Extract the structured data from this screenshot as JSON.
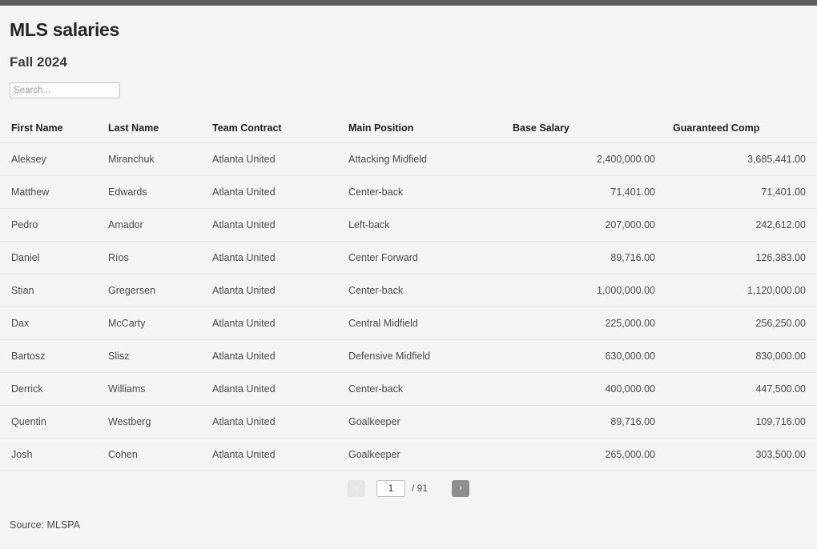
{
  "header": {
    "title": "MLS salaries",
    "subtitle": "Fall 2024"
  },
  "search": {
    "placeholder": "Search...",
    "value": ""
  },
  "table": {
    "columns": [
      "First Name",
      "Last Name",
      "Team Contract",
      "Main Position",
      "Base Salary",
      "Guaranteed Comp"
    ],
    "rows": [
      {
        "first_name": "Aleksey",
        "last_name": "Miranchuk",
        "team": "Atlanta United",
        "position": "Attacking Midfield",
        "base_salary": "2,400,000.00",
        "guaranteed_comp": "3,685,441.00"
      },
      {
        "first_name": "Matthew",
        "last_name": "Edwards",
        "team": "Atlanta United",
        "position": "Center-back",
        "base_salary": "71,401.00",
        "guaranteed_comp": "71,401.00"
      },
      {
        "first_name": "Pedro",
        "last_name": "Amador",
        "team": "Atlanta United",
        "position": "Left-back",
        "base_salary": "207,000.00",
        "guaranteed_comp": "242,612.00"
      },
      {
        "first_name": "Daniel",
        "last_name": "Ríos",
        "team": "Atlanta United",
        "position": "Center Forward",
        "base_salary": "89,716.00",
        "guaranteed_comp": "126,383.00"
      },
      {
        "first_name": "Stian",
        "last_name": "Gregersen",
        "team": "Atlanta United",
        "position": "Center-back",
        "base_salary": "1,000,000.00",
        "guaranteed_comp": "1,120,000.00"
      },
      {
        "first_name": "Dax",
        "last_name": "McCarty",
        "team": "Atlanta United",
        "position": "Central Midfield",
        "base_salary": "225,000.00",
        "guaranteed_comp": "256,250.00"
      },
      {
        "first_name": "Bartosz",
        "last_name": "Slisz",
        "team": "Atlanta United",
        "position": "Defensive Midfield",
        "base_salary": "630,000.00",
        "guaranteed_comp": "830,000.00"
      },
      {
        "first_name": "Derrick",
        "last_name": "Williams",
        "team": "Atlanta United",
        "position": "Center-back",
        "base_salary": "400,000.00",
        "guaranteed_comp": "447,500.00"
      },
      {
        "first_name": "Quentin",
        "last_name": "Westberg",
        "team": "Atlanta United",
        "position": "Goalkeeper",
        "base_salary": "89,716.00",
        "guaranteed_comp": "109,716.00"
      },
      {
        "first_name": "Josh",
        "last_name": "Cohen",
        "team": "Atlanta United",
        "position": "Goalkeeper",
        "base_salary": "265,000.00",
        "guaranteed_comp": "303,500.00"
      }
    ]
  },
  "pagination": {
    "prev_label": "‹",
    "next_label": "›",
    "current_page": "1",
    "total_pages_label": "/ 91"
  },
  "footer": {
    "source": "Source: MLSPA"
  }
}
